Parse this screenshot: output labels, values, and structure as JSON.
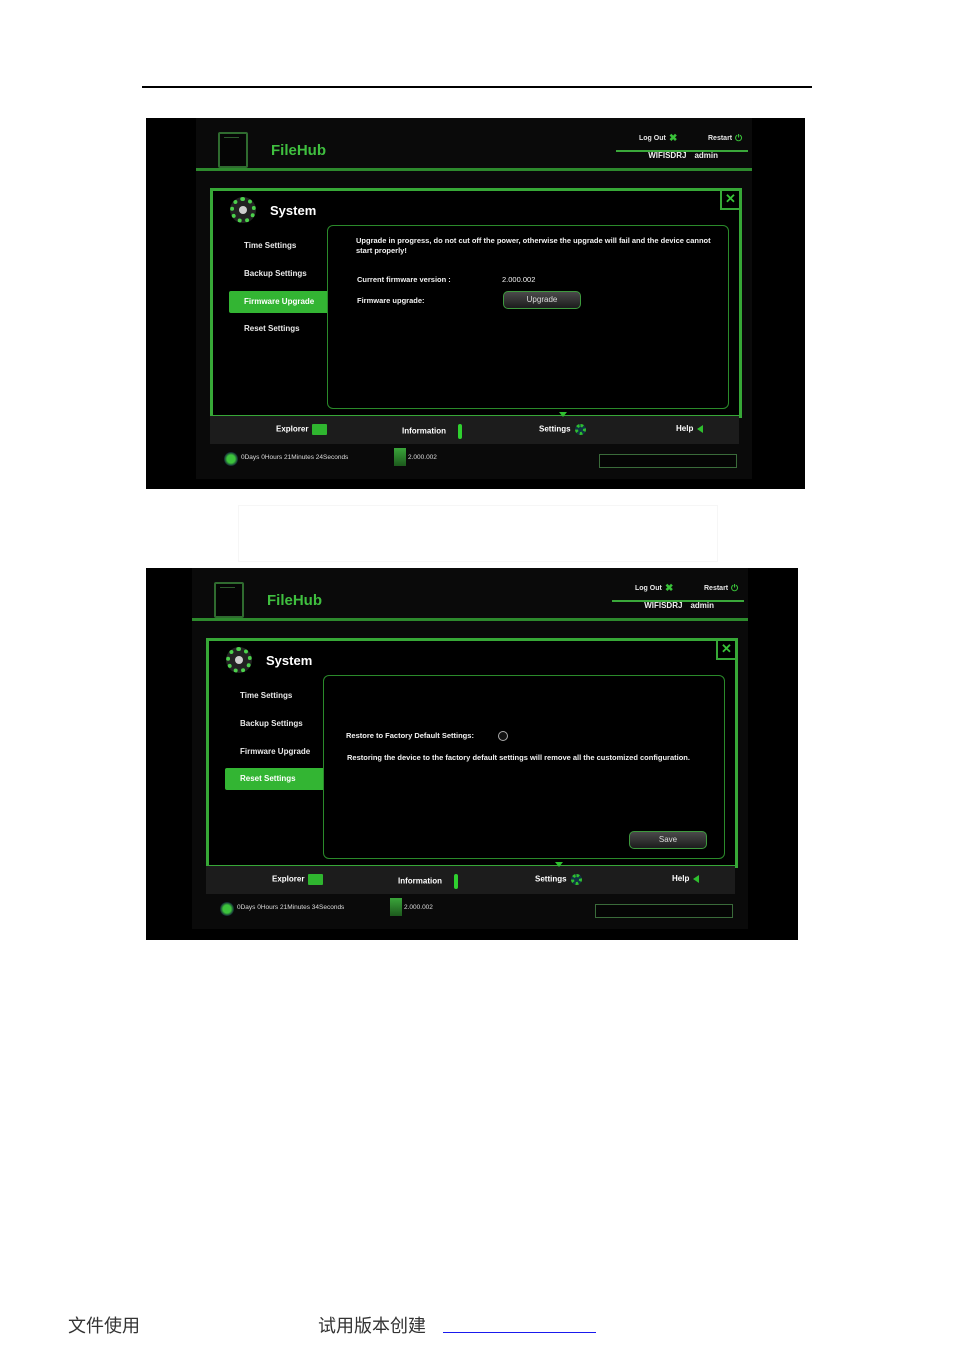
{
  "screens": [
    {
      "app_title": "FileHub",
      "top_links": {
        "logout": "Log Out",
        "restart": "Restart"
      },
      "user": {
        "name": "WIFISDRJ",
        "role": "admin"
      },
      "section_title": "System",
      "sidebar": [
        "Time Settings",
        "Backup Settings",
        "Firmware Upgrade",
        "Reset Settings"
      ],
      "active_item": "Firmware Upgrade",
      "content": {
        "warning": "Upgrade in progress, do not cut off the power, otherwise the upgrade will fail and the device cannot start properly!",
        "current_label": "Current firmware version :",
        "current_value": "2.000.002",
        "upgrade_label": "Firmware upgrade:",
        "upgrade_button": "Upgrade"
      },
      "nav": {
        "explorer": "Explorer",
        "information": "Information",
        "settings": "Settings",
        "help": "Help"
      },
      "status": {
        "uptime": "0Days 0Hours 21Minutes 24Seconds",
        "version": "2.000.002"
      }
    },
    {
      "app_title": "FileHub",
      "top_links": {
        "logout": "Log Out",
        "restart": "Restart"
      },
      "user": {
        "name": "WIFISDRJ",
        "role": "admin"
      },
      "section_title": "System",
      "sidebar": [
        "Time Settings",
        "Backup Settings",
        "Firmware Upgrade",
        "Reset Settings"
      ],
      "active_item": "Reset Settings",
      "content": {
        "restore_label": "Restore to Factory Default Settings:",
        "restore_note": "Restoring the device to the factory default settings will remove all the customized configuration.",
        "save_button": "Save"
      },
      "nav": {
        "explorer": "Explorer",
        "information": "Information",
        "settings": "Settings",
        "help": "Help"
      },
      "status": {
        "uptime": "0Days 0Hours 21Minutes 34Seconds",
        "version": "2.000.002"
      }
    }
  ],
  "footer": {
    "left": "文件使用",
    "center": "试用版本创建"
  },
  "colors": {
    "accent": "#33b533",
    "background": "#000000"
  }
}
